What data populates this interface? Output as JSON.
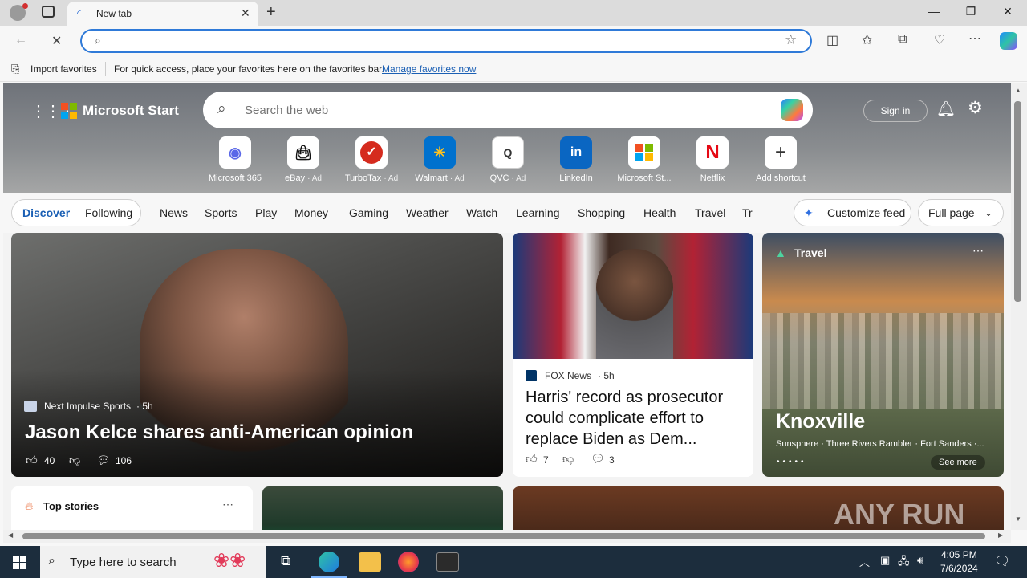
{
  "browser": {
    "tab_title": "New tab",
    "address_placeholder": "",
    "favorites_bar": {
      "import_label": "Import favorites",
      "message": "For quick access, place your favorites here on the favorites bar.",
      "manage_link": "Manage favorites now"
    }
  },
  "start": {
    "brand": "Microsoft Start",
    "search_placeholder": "Search the web",
    "sign_in": "Sign in",
    "shortcuts": [
      {
        "name": "Microsoft 365",
        "ad": ""
      },
      {
        "name": "eBay",
        "ad": "· Ad"
      },
      {
        "name": "TurboTax",
        "ad": "· Ad"
      },
      {
        "name": "Walmart",
        "ad": "· Ad"
      },
      {
        "name": "QVC",
        "ad": "· Ad"
      },
      {
        "name": "LinkedIn",
        "ad": ""
      },
      {
        "name": "Microsoft St...",
        "ad": ""
      },
      {
        "name": "Netflix",
        "ad": ""
      },
      {
        "name": "Add shortcut",
        "ad": ""
      }
    ],
    "feed_tabs": {
      "discover": "Discover",
      "following": "Following",
      "links": [
        "News",
        "Sports",
        "Play",
        "Money",
        "Gaming",
        "Weather",
        "Watch",
        "Learning",
        "Shopping",
        "Health",
        "Travel",
        "Tr"
      ]
    },
    "customize_feed": "Customize feed",
    "layout_select": "Full page"
  },
  "cards": {
    "main": {
      "source": "Next Impulse Sports",
      "age": "· 5h",
      "headline": "Jason Kelce shares anti-American opinion",
      "likes": "40",
      "comments": "106"
    },
    "news": {
      "source": "FOX News",
      "age": "· 5h",
      "headline": "Harris' record as prosecutor could complicate effort to replace Biden as Dem...",
      "likes": "7",
      "comments": "3"
    },
    "travel": {
      "label": "Travel",
      "city": "Knoxville",
      "places": "Sunsphere · Three Rivers Rambler · Fort Sanders ·...",
      "see_more": "See more"
    },
    "top_stories": "Top stories"
  },
  "watermark": "ANY RUN",
  "taskbar": {
    "search_placeholder": "Type here to search",
    "time": "4:05 PM",
    "date": "7/6/2024"
  }
}
